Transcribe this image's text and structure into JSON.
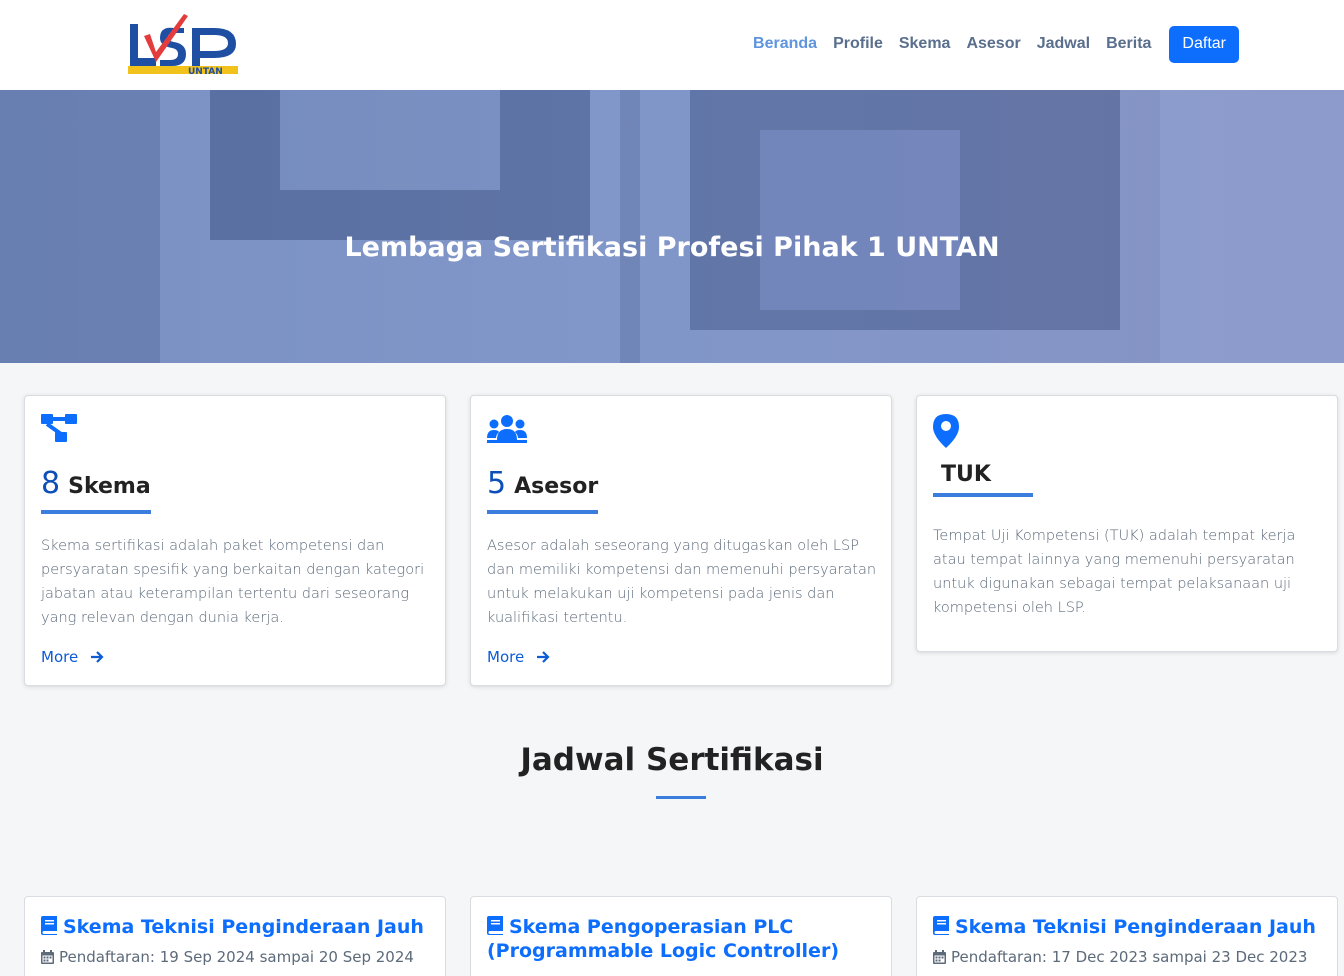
{
  "header": {
    "logo_text": "LSP UNTAN",
    "nav": [
      {
        "label": "Beranda",
        "active": true
      },
      {
        "label": "Profile",
        "active": false
      },
      {
        "label": "Skema",
        "active": false
      },
      {
        "label": "Asesor",
        "active": false
      },
      {
        "label": "Jadwal",
        "active": false
      },
      {
        "label": "Berita",
        "active": false
      }
    ],
    "cta_label": "Daftar"
  },
  "hero": {
    "title": "Lembaga Sertifikasi Profesi Pihak 1 UNTAN"
  },
  "cards": [
    {
      "icon": "sitemap-icon",
      "number": "8",
      "label": "Skema",
      "description": "Skema sertifikasi adalah paket kompetensi dan persyaratan spesifik yang berkaitan dengan kategori jabatan atau keterampilan tertentu dari seseorang yang relevan dengan dunia kerja.",
      "more": "More"
    },
    {
      "icon": "users-icon",
      "number": "5",
      "label": "Asesor",
      "description": "Asesor adalah seseorang yang ditugaskan oleh LSP dan memiliki kompetensi dan memenuhi persyaratan untuk melakukan uji kompetensi pada jenis dan kualifikasi tertentu.",
      "more": "More"
    },
    {
      "icon": "map-marker-icon",
      "label": "TUK",
      "description": "Tempat Uji Kompetensi (TUK) adalah tempat kerja atau tempat lainnya yang memenuhi persyaratan untuk digunakan sebagai tempat pelaksanaan uji kompetensi oleh LSP."
    }
  ],
  "schedule": {
    "title": "Jadwal Sertifikasi",
    "items": [
      {
        "title": "Skema Teknisi Penginderaan Jauh",
        "date": "Pendaftaran: 19 Sep 2024 sampai 20 Sep 2024"
      },
      {
        "title": "Skema Pengoperasian PLC (Programmable Logic Controller)",
        "date": ""
      },
      {
        "title": "Skema Teknisi Penginderaan Jauh",
        "date": "Pendaftaran: 17 Dec 2023 sampai 23 Dec 2023"
      }
    ]
  },
  "colors": {
    "primary": "#0d6efd",
    "accent_underline": "#3b7ddd",
    "nav_text": "#5a6f8d",
    "nav_active": "#5f95dc"
  }
}
